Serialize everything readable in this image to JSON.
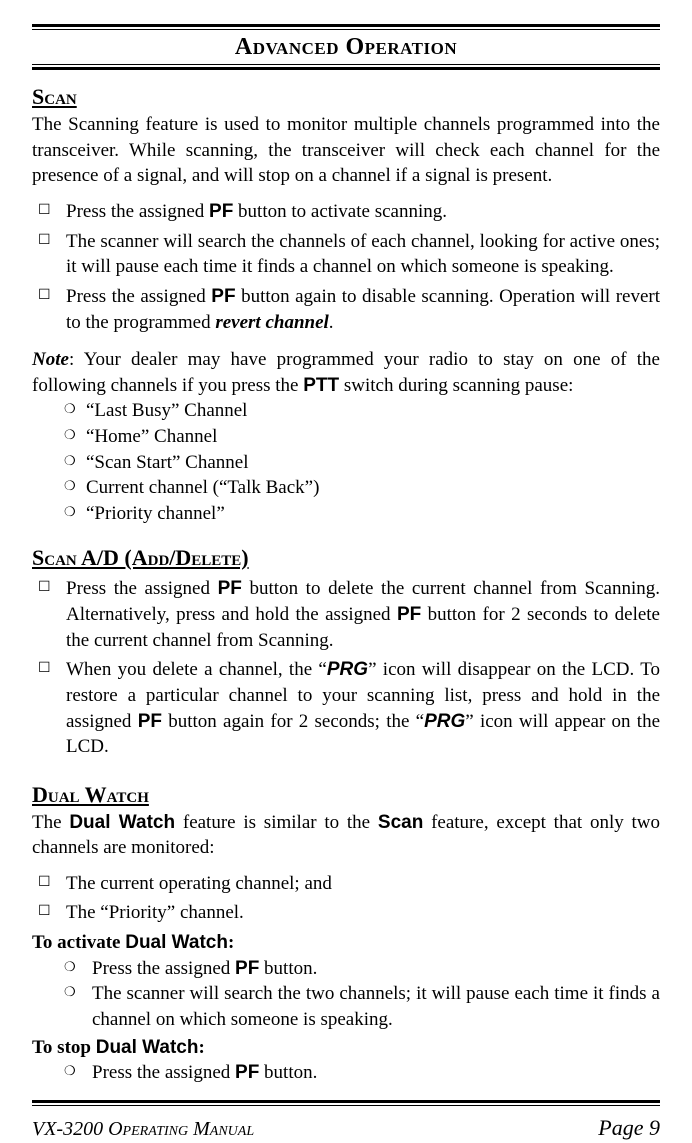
{
  "title": "Advanced Operation",
  "sections": {
    "scan": {
      "heading": "Scan",
      "intro": "The Scanning feature is used to monitor multiple channels programmed into the trans­ceiver. While scanning, the transceiver will check each channel for the presence of a signal, and will stop on a channel if a signal is present.",
      "b1a": "Press the assigned ",
      "b1b": "PF",
      "b1c": " button to activate scanning.",
      "b2": "The scanner will search the channels of each channel, looking for active ones; it will pause each time it finds a channel on which someone is speaking.",
      "b3a": "Press the assigned ",
      "b3b": "PF",
      "b3c": " button again to disable scanning. Operation will revert to the programmed ",
      "b3d": "revert channel",
      "b3e": ".",
      "note_a": "Note",
      "note_b": ": Your dealer may have programmed your radio to stay on one of the following channels if you press the ",
      "note_c": "PTT",
      "note_d": " switch during scanning pause:",
      "c1": "“Last Busy” Channel",
      "c2": "“Home” Channel",
      "c3": "“Scan Start” Channel",
      "c4": "Current channel (“Talk Back”)",
      "c5": "“Priority channel”"
    },
    "scanad": {
      "heading": "Scan A/D (Add/Delete)",
      "b1a": "Press the assigned ",
      "b1b": "PF",
      "b1c": " button to delete the current channel from Scanning. Alter­natively, press and hold the assigned ",
      "b1d": "PF",
      "b1e": " button for 2 seconds to delete the current channel from Scanning.",
      "b2a": "When you delete a channel, the “",
      "b2b": "PRG",
      "b2c": "” icon will disappear on the LCD. To restore a particular channel to your scanning list, press and hold in the assigned ",
      "b2d": "PF",
      "b2e": " button again for 2 seconds; the “",
      "b2f": "PRG",
      "b2g": "” icon will appear on the LCD."
    },
    "dual": {
      "heading": "Dual Watch",
      "intro_a": "The ",
      "intro_b": "Dual Watch",
      "intro_c": " feature is similar to the ",
      "intro_d": "Scan",
      "intro_e": " feature, except that only two chan­nels are monitored:",
      "b1": "The current operating channel; and",
      "b2": "The “Priority” channel.",
      "act_a": "To activate ",
      "act_b": "Dual Watch",
      "act_c": ":",
      "c1a": "Press the assigned ",
      "c1b": "PF",
      "c1c": " button.",
      "c2": "The scanner will search the two channels; it will pause each time it finds a channel on which someone is speaking.",
      "stop_a": "To stop ",
      "stop_b": "Dual Watch",
      "stop_c": ":",
      "c3a": "Press the assigned ",
      "c3b": "PF",
      "c3c": " button."
    }
  },
  "footer": {
    "left": "VX-3200 Operating Manual",
    "right": "Page 9"
  }
}
